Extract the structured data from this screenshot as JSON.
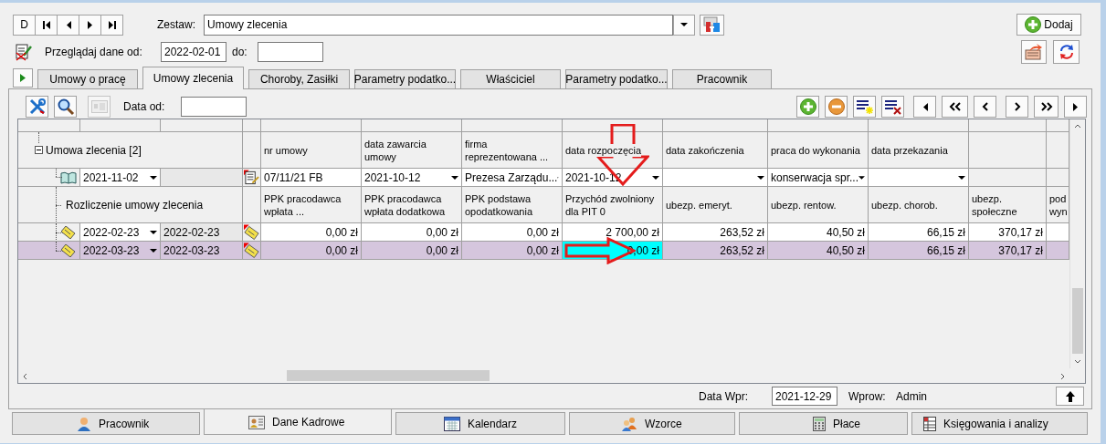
{
  "toolbar": {
    "record_button": "D"
  },
  "zestaw": {
    "label": "Zestaw:",
    "value": "Umowy zlecenia"
  },
  "add_button": "Dodaj",
  "filter": {
    "from_label": "Przeglądaj dane od:",
    "from_value": "2022-02-01",
    "to_label": "do:"
  },
  "tabs": [
    {
      "label": "Umowy o pracę",
      "selected": false
    },
    {
      "label": "Umowy zlecenia",
      "selected": true
    },
    {
      "label": "Choroby, Zasiłki",
      "selected": false
    },
    {
      "label": "Parametry podatko...",
      "selected": false
    },
    {
      "label": "Właściciel",
      "selected": false
    },
    {
      "label": "Parametry podatko...",
      "selected": false
    },
    {
      "label": "Pracownik",
      "selected": false
    }
  ],
  "grid_toolbar": {
    "date_label": "Data od:"
  },
  "grid": {
    "group": {
      "label": "Umowa zlecenia [2]",
      "expanded": true,
      "columns": [
        "nr umowy",
        "data zawarcia umowy",
        "firma reprezentowana ...",
        "data rozpoczęcia",
        "data zakończenia",
        "praca do wykonania",
        "data przekazania"
      ],
      "record": {
        "date": "2021-11-02",
        "cells": [
          {
            "text": "07/11/21 FB",
            "dropdown": false
          },
          {
            "text": "2021-10-12",
            "dropdown": true
          },
          {
            "text": "Prezesa Zarządu...",
            "dropdown": true
          },
          {
            "text": "2021-10-12",
            "dropdown": true
          },
          {
            "dropdown": true
          },
          {
            "text": "konserwacja spr...",
            "dropdown": true
          },
          {
            "dropdown": true
          }
        ]
      }
    },
    "sub": {
      "label": "Rozliczenie umowy zlecenia",
      "columns": [
        "PPK pracodawca wpłata ...",
        "PPK pracodawca wpłata dodatkowa",
        "PPK podstawa opodatkowania",
        "Przychód zwolniony dla PIT 0",
        "ubezp. emeryt.",
        "ubezp. rentow.",
        "ubezp. chorob.",
        "ubezp. społeczne",
        "pod wyn"
      ],
      "rows": [
        {
          "date_from": "2022-02-23",
          "date_to": "2022-02-23",
          "selected": false,
          "cells": [
            {
              "text": "0,00 zł",
              "focused": false
            },
            {
              "text": "0,00 zł",
              "focused": false
            },
            {
              "text": "0,00 zł",
              "focused": false
            },
            {
              "text": "2 700,00 zł",
              "focused": false
            },
            {
              "text": "263,52 zł",
              "focused": false
            },
            {
              "text": "40,50 zł",
              "focused": false
            },
            {
              "text": "66,15 zł",
              "focused": false
            },
            {
              "text": "370,17 zł",
              "focused": false
            }
          ]
        },
        {
          "date_from": "2022-03-23",
          "date_to": "2022-03-23",
          "selected": true,
          "cells": [
            {
              "text": "0,00 zł",
              "focused": false
            },
            {
              "text": "0,00 zł",
              "focused": false
            },
            {
              "text": "0,00 zł",
              "focused": false
            },
            {
              "text": "0,00 zł",
              "focused": true
            },
            {
              "text": "263,52 zł",
              "focused": false
            },
            {
              "text": "40,50 zł",
              "focused": false
            },
            {
              "text": "66,15 zł",
              "focused": false
            },
            {
              "text": "370,17 zł",
              "focused": false
            }
          ]
        }
      ]
    },
    "annotations": [
      {
        "kind": "arrow-down"
      },
      {
        "kind": "arrow-right"
      }
    ]
  },
  "footer": {
    "entered_label": "Data Wpr:",
    "entered_value": "2021-12-29",
    "user_label": "Wprow:",
    "user_value": "Admin"
  },
  "bottom_tabs": [
    {
      "label": "Pracownik",
      "selected": false
    },
    {
      "label": "Dane Kadrowe",
      "selected": true
    },
    {
      "label": "Kalendarz",
      "selected": false
    },
    {
      "label": "Wzorce",
      "selected": false
    },
    {
      "label": "Płace",
      "selected": false
    },
    {
      "label": "Księgowania i analizy",
      "selected": false
    }
  ]
}
